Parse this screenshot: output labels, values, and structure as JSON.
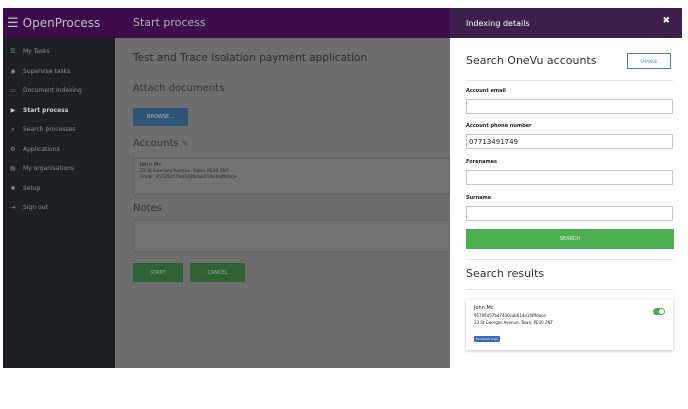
{
  "app": {
    "brand": "OpenProcess",
    "page_title": "Start process"
  },
  "sidebar": {
    "items": [
      {
        "icon": "list-icon",
        "glyph": "☰",
        "label": "My Tasks"
      },
      {
        "icon": "eye-icon",
        "glyph": "◉",
        "label": "Supervise tasks"
      },
      {
        "icon": "inbox-icon",
        "glyph": "▭",
        "label": "Document Indexing"
      },
      {
        "icon": "play-icon",
        "glyph": "▶",
        "label": "Start process"
      },
      {
        "icon": "search-icon",
        "glyph": "⌕",
        "label": "Search processes"
      },
      {
        "icon": "applications-icon",
        "glyph": "⚙",
        "label": "Applications"
      },
      {
        "icon": "building-icon",
        "glyph": "▤",
        "label": "My organisations"
      },
      {
        "icon": "gear-icon",
        "glyph": "✱",
        "label": "Setup"
      },
      {
        "icon": "sign-out-icon",
        "glyph": "⇥",
        "label": "Sign out"
      }
    ]
  },
  "main": {
    "process_title": "Test and Trace Isolation payment application",
    "attach_heading": "Attach documents",
    "browse_label": "BROWSE...",
    "accounts_heading": "Accounts",
    "account": {
      "name": "John Mc",
      "address": "23 St Georges Avenue, Town, PE30 2NT",
      "email": "Email: 95735d57bd7400cab614e1fdffdace"
    },
    "notes_heading": "Notes",
    "start_label": "START",
    "cancel_label": "CANCEL"
  },
  "drawer": {
    "title": "Indexing details",
    "close_glyph": "✖",
    "search_title": "Search OneVu accounts",
    "change_label": "CHANGE",
    "fields": {
      "email_label": "Account email",
      "email_value": "",
      "phone_label": "Account phone number",
      "phone_value": "07713491749",
      "forenames_label": "Forenames",
      "forenames_value": "",
      "surname_label": "Surname",
      "surname_value": ""
    },
    "search_label": "SEARCH",
    "results_title": "Search results",
    "result": {
      "name": "John Mc",
      "id": "95706d57bd7400cab614e1fdffdace",
      "address": "23 St Georges Avenue, Town, PE30 2NT",
      "badge": "Facebook login",
      "selected": true
    }
  },
  "colors": {
    "topbar": "#3c0c4c",
    "sidebar": "#1c2026",
    "overlay": "#6f6f6f",
    "success": "#4caf50",
    "link": "#4a7fb6"
  }
}
